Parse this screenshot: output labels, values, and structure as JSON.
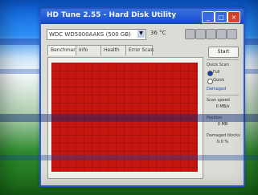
{
  "window": {
    "title": "HD Tune 2.55 - Hard Disk Utility",
    "controls": {
      "minimize": "_",
      "maximize": "□",
      "close": "×"
    }
  },
  "toolbar": {
    "drive_value": "WDC WD5000AAKS (500 GB)",
    "speed_label": "36 °C"
  },
  "tabs": [
    {
      "label": "Benchmark"
    },
    {
      "label": "Info"
    },
    {
      "label": "Health"
    },
    {
      "label": "Error Scan"
    }
  ],
  "sidepanel": {
    "start_label": "Start",
    "quick_scan_label": "Quick Scan",
    "radio_options": [
      {
        "label": "Full",
        "selected": true
      },
      {
        "label": "Quick",
        "selected": false
      }
    ],
    "damaged_label": "Damaged",
    "scan_speed_label": "Scan speed",
    "scan_speed_value": "0 MB/s",
    "position_label": "Position",
    "position_value": "0 MB",
    "damaged_blocks_label": "Damaged blocks",
    "damaged_blocks_value": "0.0 %"
  },
  "scan_grid": {
    "fill_color": "#c4150f"
  }
}
